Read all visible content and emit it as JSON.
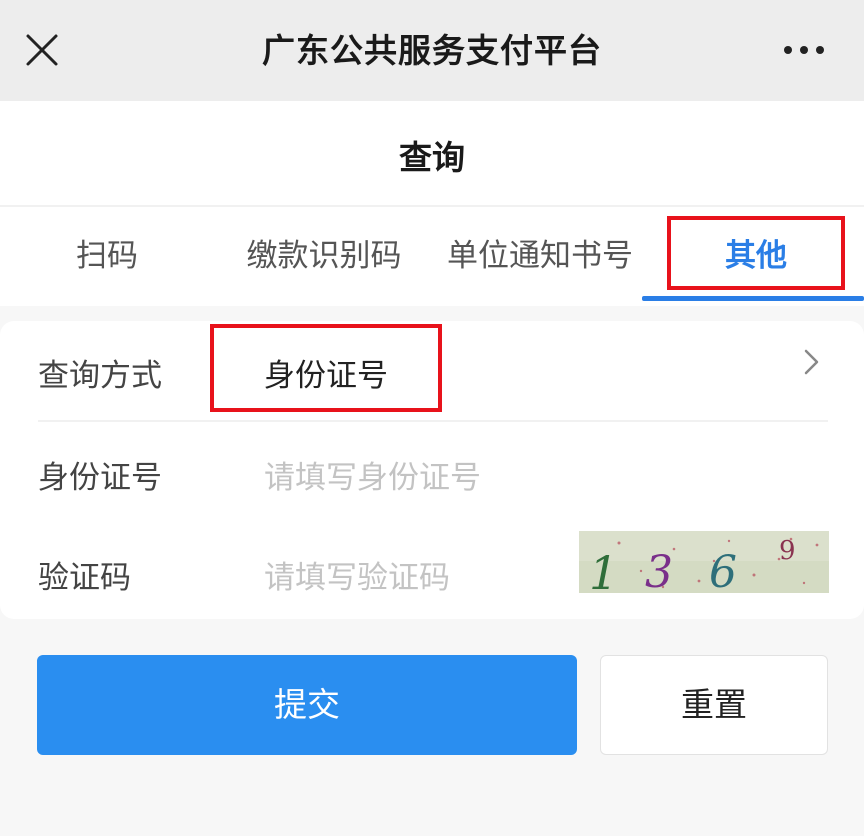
{
  "window": {
    "title": "广东公共服务支付平台",
    "close_icon": "close-icon",
    "more_icon": "more-dots-icon"
  },
  "page": {
    "title": "查询"
  },
  "tabs": [
    {
      "label": "扫码",
      "active": false
    },
    {
      "label": "缴款识别码",
      "active": false
    },
    {
      "label": "单位通知书号",
      "active": false
    },
    {
      "label": "其他",
      "active": true
    }
  ],
  "form": {
    "method": {
      "label": "查询方式",
      "value": "身份证号",
      "icon": "chevron-right-icon"
    },
    "id_number": {
      "label": "身份证号",
      "placeholder": "请填写身份证号"
    },
    "captcha": {
      "label": "验证码",
      "placeholder": "请填写验证码",
      "image_text": "1369"
    }
  },
  "actions": {
    "submit_label": "提交",
    "reset_label": "重置"
  },
  "colors": {
    "accent": "#2a7ee6",
    "primary_button": "#2a8ef0",
    "highlight": "#e8121b"
  }
}
